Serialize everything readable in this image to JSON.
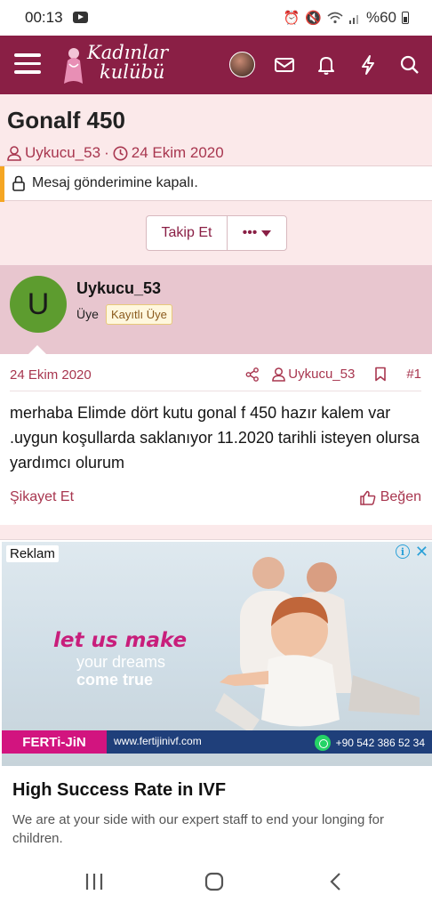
{
  "status": {
    "time": "00:13",
    "battery": "%60",
    "icons": [
      "youtube-icon",
      "alarm-icon",
      "mute-icon",
      "wifi-icon",
      "signal-icon",
      "battery-icon"
    ]
  },
  "header": {
    "logo_line1": "Kadınlar",
    "logo_line2": "kulübü",
    "brand_color": "#8a1f45",
    "icons": [
      "menu-icon",
      "user-avatar",
      "mail-icon",
      "bell-icon",
      "bolt-icon",
      "search-icon"
    ]
  },
  "thread": {
    "title": "Gonalf 450",
    "author": "Uykucu_53",
    "date": "24 Ekim 2020",
    "locked_notice": "Mesaj gönderimine kapalı.",
    "follow_label": "Takip Et",
    "more_label": "•••"
  },
  "user": {
    "initial": "U",
    "name": "Uykucu_53",
    "role": "Üye",
    "badge": "Kayıtlı Üye",
    "avatar_color": "#5d9c2f"
  },
  "post": {
    "date": "24 Ekim 2020",
    "author": "Uykucu_53",
    "number": "#1",
    "body": "merhaba Elimde dört kutu gonal f 450 hazır kalem var .uygun koşullarda saklanıyor 11.2020 tarihli isteyen olursa yardımcı olurum",
    "report_label": "Şikayet Et",
    "like_label": "Beğen"
  },
  "ad": {
    "label": "Reklam",
    "headline1": "let us make",
    "headline2": "your dreams",
    "headline3": "come true",
    "brand": "FERTi-JiN",
    "url": "www.fertijinivf.com",
    "phone": "+90 542 386 52 34",
    "title": "High Success Rate in IVF",
    "description": "We are at your side with our expert staff to end your longing for children."
  }
}
